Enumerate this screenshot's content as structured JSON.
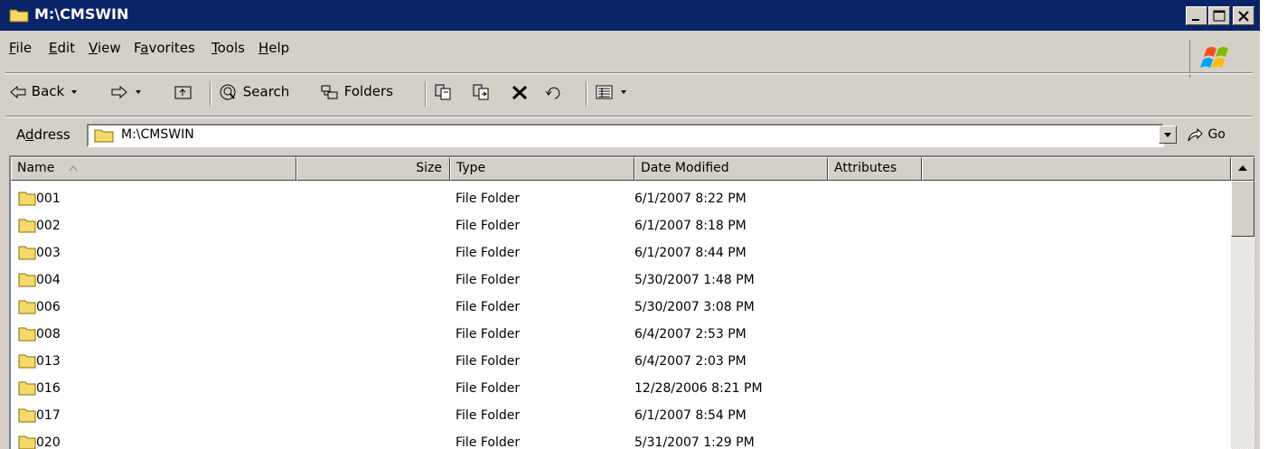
{
  "window": {
    "title": "M:\\CMSWIN"
  },
  "menu": {
    "items": [
      {
        "label": "File",
        "accel": "F",
        "rest": "ile"
      },
      {
        "label": "Edit",
        "accel": "E",
        "rest": "dit"
      },
      {
        "label": "View",
        "accel": "V",
        "rest": "iew"
      },
      {
        "label": "Favorites",
        "accel": "a",
        "pre": "F",
        "rest": "vorites"
      },
      {
        "label": "Tools",
        "accel": "T",
        "rest": "ools"
      },
      {
        "label": "Help",
        "accel": "H",
        "rest": "elp"
      }
    ]
  },
  "toolbar": {
    "back_label": "Back",
    "search_label": "Search",
    "folders_label": "Folders"
  },
  "address": {
    "label": "Address",
    "label_accel": "d",
    "value": "M:\\CMSWIN",
    "go_label": "Go"
  },
  "columns": {
    "name": "Name",
    "size": "Size",
    "type": "Type",
    "date": "Date Modified",
    "attributes": "Attributes"
  },
  "rows": [
    {
      "name": "001",
      "type": "File Folder",
      "date": "6/1/2007 8:22 PM"
    },
    {
      "name": "002",
      "type": "File Folder",
      "date": "6/1/2007 8:18 PM"
    },
    {
      "name": "003",
      "type": "File Folder",
      "date": "6/1/2007 8:44 PM"
    },
    {
      "name": "004",
      "type": "File Folder",
      "date": "5/30/2007 1:48 PM"
    },
    {
      "name": "006",
      "type": "File Folder",
      "date": "5/30/2007 3:08 PM"
    },
    {
      "name": "008",
      "type": "File Folder",
      "date": "6/4/2007 2:53 PM"
    },
    {
      "name": "013",
      "type": "File Folder",
      "date": "6/4/2007 2:03 PM"
    },
    {
      "name": "016",
      "type": "File Folder",
      "date": "12/28/2006 8:21 PM"
    },
    {
      "name": "017",
      "type": "File Folder",
      "date": "6/1/2007 8:54 PM"
    },
    {
      "name": "020",
      "type": "File Folder",
      "date": "5/31/2007 1:29 PM"
    }
  ],
  "colors": {
    "titlebar": "#0a246a",
    "face": "#d4d0c8",
    "folder": "#f5d96b"
  },
  "icons": [
    "folder-icon",
    "back-arrow-icon",
    "forward-arrow-icon",
    "up-folder-icon",
    "search-icon",
    "folders-icon",
    "move-to-icon",
    "copy-to-icon",
    "delete-icon",
    "undo-icon",
    "views-icon",
    "go-arrow-icon",
    "windows-logo-icon"
  ]
}
